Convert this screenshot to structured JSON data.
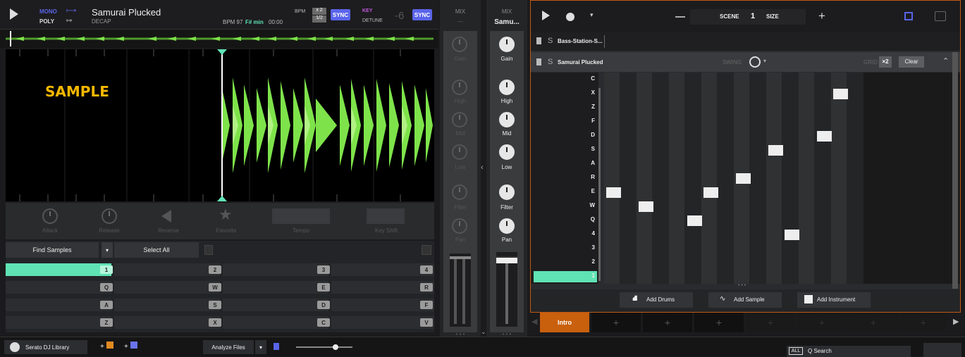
{
  "deck": {
    "mode_top": "MONO",
    "mode_bottom": "POLY",
    "track_title": "Samurai Plucked",
    "track_sub": "DECAP",
    "bpm_label": "BPM 97",
    "key_label": "F# min",
    "time": "00:00",
    "bpm_title": "BPM",
    "mult_top": "x 2",
    "mult_bottom": "1/2",
    "sync1": "SYNC",
    "key_title": "KEY",
    "detune": "DETUNE",
    "detune_value": "-6",
    "sync2": "SYNC",
    "sample_overlay": "SAMPLE"
  },
  "controls": {
    "attack": "Attack",
    "release": "Release",
    "reverse": "Reverse",
    "favorite": "Favorite",
    "tempo": "Tempo",
    "keyshift": "Key Shift"
  },
  "samples": {
    "find": "Find Samples",
    "select_all": "Select All",
    "keys": [
      "1",
      "2",
      "3",
      "4",
      "Q",
      "W",
      "E",
      "R",
      "A",
      "S",
      "D",
      "F",
      "Z",
      "X",
      "C",
      "V"
    ]
  },
  "mix1": {
    "title": "MIX",
    "sub": "---",
    "labels": [
      "Gain",
      "High",
      "Mid",
      "Low",
      "Filter",
      "Pan"
    ]
  },
  "mix2": {
    "title": "MIX",
    "sub": "Samu...",
    "labels": [
      "Gain",
      "High",
      "Mid",
      "Low",
      "Filter",
      "Pan"
    ]
  },
  "scene": {
    "label": "SCENE",
    "number": "1",
    "size": "SIZE"
  },
  "tracks": {
    "track1": "Bass-Station-S...",
    "track2": "Samurai Plucked",
    "swing": "SWING",
    "grid": "GRID",
    "grid_mult": "×2",
    "clear": "Clear",
    "s_label": "S"
  },
  "piano_rows": [
    "C",
    "X",
    "Z",
    "F",
    "D",
    "S",
    "A",
    "R",
    "E",
    "W",
    "Q",
    "4",
    "3",
    "2",
    "1"
  ],
  "add": {
    "drums": "Add Drums",
    "sample": "Add Sample",
    "instrument": "Add Instrument"
  },
  "scenes": {
    "intro": "Intro",
    "plus": "+"
  },
  "bottom": {
    "library": "Serato DJ Library",
    "analyze": "Analyze Files",
    "all": "ALL",
    "search": "Q Search"
  },
  "colors": {
    "accent": "#5a64ea",
    "highlight": "#5fe3b4",
    "orange": "#c9600d",
    "sample_text": "#f5b800",
    "waveform": "#7ee34a"
  }
}
